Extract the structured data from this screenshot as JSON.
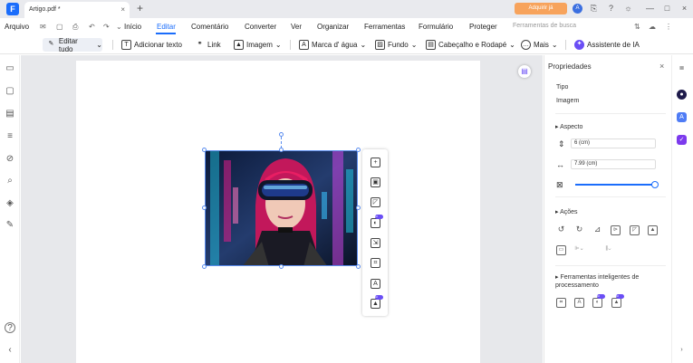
{
  "window": {
    "tab_title": "Artigo.pdf *",
    "tab_close": "×",
    "new_tab": "+",
    "buy_label": "Adquirir já",
    "logo": "F",
    "avatar_letter": "A",
    "controls": [
      "⎘",
      "?",
      "☼",
      "—",
      "□",
      "×"
    ]
  },
  "menu": {
    "file": "Arquivo",
    "quick_icons": [
      "✉",
      "▢",
      "⎙",
      "↶",
      "↷",
      "⌄"
    ],
    "items": [
      "Início",
      "Editar",
      "Comentário",
      "Converter",
      "Ver",
      "Organizar",
      "Ferramentas",
      "Formulário",
      "Proteger"
    ],
    "active_index": 1,
    "search_placeholder": "Ferramentas de busca",
    "right_icons": [
      "⇅",
      "☁",
      "⋮"
    ]
  },
  "toolbar": {
    "edit_all": "Editar tudo",
    "add_text": "Adicionar texto",
    "link": "Link",
    "image": "Imagem",
    "watermark": "Marca d' água",
    "background": "Fundo",
    "header_footer": "Cabeçalho e Rodapé",
    "more": "Mais",
    "assistant": "Assistente de IA"
  },
  "left_icons": [
    "▭",
    "▢",
    "▤",
    "≡",
    "⊘",
    "⌕",
    "◈",
    "✎",
    "?",
    "‹"
  ],
  "floating_toolbar": [
    {
      "icon": "add-image-icon",
      "glyph": "+",
      "ai": false
    },
    {
      "icon": "save-image-icon",
      "glyph": "▣",
      "ai": false
    },
    {
      "icon": "crop-icon",
      "glyph": "◸",
      "ai": false
    },
    {
      "icon": "ai-remove-bg-icon",
      "glyph": "◐",
      "ai": true
    },
    {
      "icon": "extract-image-icon",
      "glyph": "⇲",
      "ai": false
    },
    {
      "icon": "ocr-icon",
      "glyph": "⌗",
      "ai": false
    },
    {
      "icon": "translate-image-icon",
      "glyph": "A",
      "ai": false
    },
    {
      "icon": "ai-enhance-icon",
      "glyph": "▲",
      "ai": true
    }
  ],
  "ai_badge": "AI",
  "properties": {
    "title": "Propriedades",
    "close": "×",
    "type_label": "Tipo",
    "type_value": "Imagem",
    "aspect_label": "Aspecto",
    "height_value": "6 (cm)",
    "width_value": "7.99 (cm)",
    "opacity_fraction": 1.0,
    "actions_label": "Ações",
    "smart_tools_label": "Ferramentas inteligentes de processamento"
  },
  "right_icons": [
    "≣",
    "●",
    "A",
    "✓",
    "›"
  ],
  "colors": {
    "accent": "#1b6dfb",
    "buy": "#f7a35c",
    "ai_badge": "#6a4ef5"
  }
}
